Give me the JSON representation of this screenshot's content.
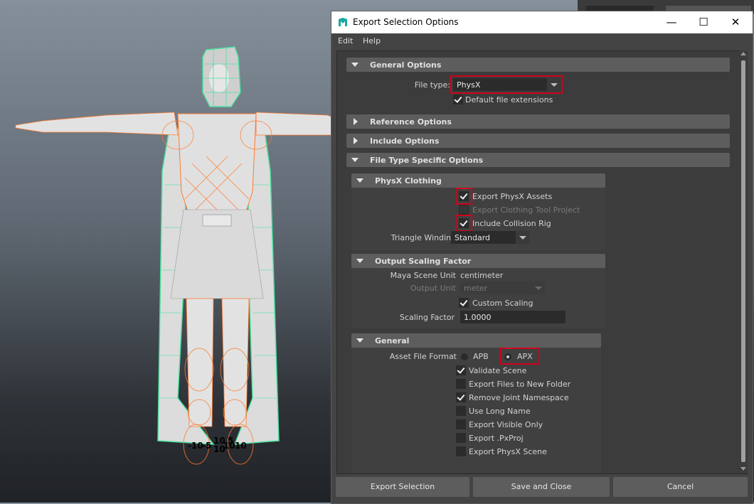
{
  "viewport": {
    "axis_labels": [
      "-10",
      "-5",
      "10",
      "10",
      "10",
      "5",
      "10"
    ]
  },
  "dialog": {
    "title": "Export Selection Options",
    "window_controls": {
      "minimize": "—",
      "maximize": "☐",
      "close": "✕"
    },
    "menu": [
      "Edit",
      "Help"
    ],
    "general_options": {
      "header": "General Options",
      "file_type_label": "File type:",
      "file_type_value": "PhysX",
      "default_ext_label": "Default file extensions",
      "default_ext_checked": true
    },
    "reference_options": {
      "header": "Reference Options"
    },
    "include_options": {
      "header": "Include Options"
    },
    "file_type_specific": {
      "header": "File Type Specific Options"
    },
    "physx_clothing": {
      "header": "PhysX Clothing",
      "export_assets_label": "Export PhysX Assets",
      "export_assets_checked": true,
      "export_ctp_label": "Export Clothing Tool Project",
      "export_ctp_checked": false,
      "include_collision_label": "Include Collision Rig",
      "include_collision_checked": true,
      "triangle_winding_label": "Triangle Winding",
      "triangle_winding_value": "Standard"
    },
    "output_scaling": {
      "header": "Output Scaling Factor",
      "scene_unit_label": "Maya Scene Unit",
      "scene_unit_value": "centimeter",
      "output_unit_label": "Output Unit",
      "output_unit_value": "meter",
      "custom_scaling_label": "Custom Scaling",
      "custom_scaling_checked": true,
      "scaling_factor_label": "Scaling Factor",
      "scaling_factor_value": "1.0000"
    },
    "general": {
      "header": "General",
      "asset_format_label": "Asset File Format",
      "apb_label": "APB",
      "apx_label": "APX",
      "selected_format": "APX",
      "options": [
        {
          "label": "Validate Scene",
          "checked": true
        },
        {
          "label": "Export Files to New Folder",
          "checked": false
        },
        {
          "label": "Remove Joint Namespace",
          "checked": true
        },
        {
          "label": "Use Long Name",
          "checked": false
        },
        {
          "label": "Export Visible Only",
          "checked": false
        },
        {
          "label": "Export .PxProj",
          "checked": false
        },
        {
          "label": "Export PhysX Scene",
          "checked": false
        }
      ]
    },
    "buttons": {
      "export_selection": "Export Selection",
      "save_and_close": "Save and Close",
      "cancel": "Cancel"
    },
    "colors": {
      "highlight": "#d0021b",
      "panel": "#444444",
      "section": "#5d5d5d"
    }
  }
}
